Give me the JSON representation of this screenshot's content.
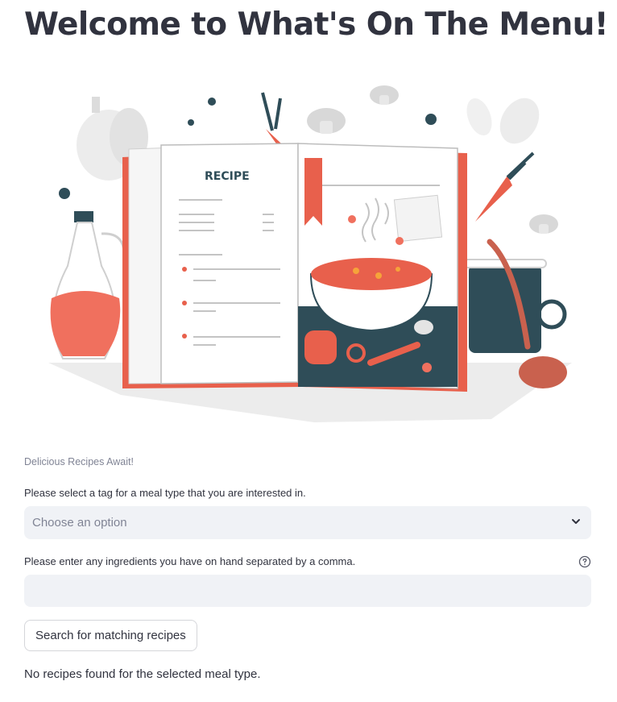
{
  "page": {
    "title": "Welcome to What's On The Menu!"
  },
  "hero": {
    "recipe_heading": "RECIPE"
  },
  "caption": "Delicious Recipes Await!",
  "meal_select": {
    "label": "Please select a tag for a meal type that you are interested in.",
    "placeholder": "Choose an option"
  },
  "ingredients": {
    "label": "Please enter any ingredients you have on hand separated by a comma.",
    "value": "",
    "help_icon": "question-circle-icon"
  },
  "search_button": {
    "label": "Search for matching recipes"
  },
  "status": "No recipes found for the selected meal type.",
  "colors": {
    "accent": "#e8604c",
    "dark_teal": "#2f4d58",
    "input_bg": "#f0f2f6",
    "text": "#31333f",
    "muted": "#808495"
  }
}
